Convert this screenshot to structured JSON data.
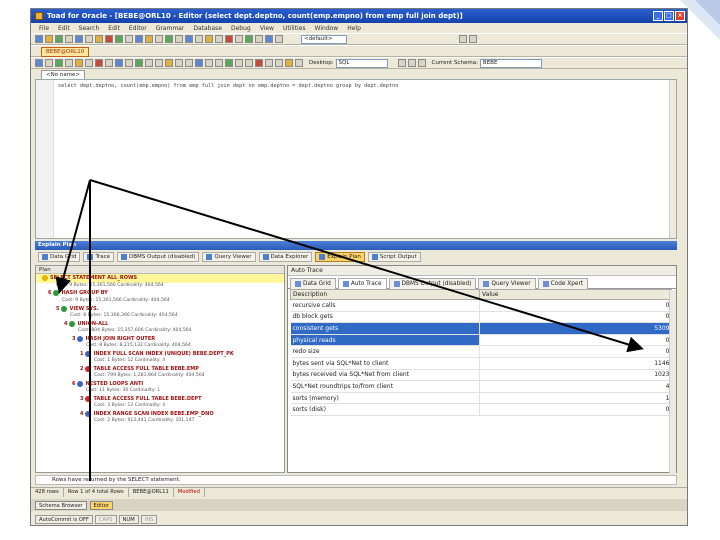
{
  "window": {
    "title": "Toad for Oracle - [BEBE@ORL10 - Editor (select dept.deptno, count(emp.empno) from emp full join dept)]"
  },
  "menu": [
    "File",
    "Edit",
    "Search",
    "Edit",
    "Editor",
    "Grammar",
    "Database",
    "Debug",
    "View",
    "Utilities",
    "Window",
    "Help"
  ],
  "toolbar": {
    "default_combo": "<default>",
    "desktop_label": "Desktop:",
    "desktop_value": "SQL",
    "schema_label": "Current Schema:",
    "schema_value": "BEBE"
  },
  "connection_tab": "BEBE@ORL10",
  "editor": {
    "tab_label": "<No name>",
    "sql": "select dept.deptno, count(emp.empno) from emp full join dept on emp.deptno = dept.deptno group by dept.deptno"
  },
  "explain": {
    "title": "Explain Plan",
    "tabs": [
      "Data Grid",
      "Trace",
      "DBMS Output (disabled)",
      "Query Viewer",
      "Data Explorer",
      "Explain Plan",
      "Script Output"
    ],
    "plan_header": "Plan",
    "nodes": [
      {
        "label": "SELECT STATEMENT ALL_ROWS",
        "cost": "Cost: 9 Bytes: 15,361,566  Cardinality: 404,564"
      },
      {
        "num": "6",
        "label": "HASH GROUP BY",
        "cost": "Cost: 9 Bytes: 15,361,566  Cardinality: 404,564"
      },
      {
        "num": "5",
        "label": "VIEW SYS.",
        "cost": "Cost: 8 Bytes: 15,366,366  Cardinality: 404,564"
      },
      {
        "num": "4",
        "label": "UNION-ALL",
        "cost": "Cost: 804 Bytes: 15,357,606  Cardinality: 404,564"
      },
      {
        "num": "3",
        "label": "HASH JOIN RIGHT OUTER",
        "cost": "Cost: 8 Bytes: 8,215,132  Cardinality: 404,564"
      },
      {
        "num": "1",
        "label": "INDEX FULL SCAN INDEX (UNIQUE) BEBE.DEPT_PK",
        "cost": "Cost: 1 Bytes: 12  Cardinality: 4"
      },
      {
        "num": "2",
        "label": "TABLE ACCESS FULL TABLE BEBE.EMP",
        "cost": "Cost: 799 Bytes: 1,281,864  Cardinality: 404,564"
      },
      {
        "num": "6",
        "label": "NESTED LOOPS ANTI",
        "cost": "Cost: 11 Bytes: 30  Cardinality: 1"
      },
      {
        "num": "3",
        "label": "TABLE ACCESS FULL TABLE BEBE.DEPT",
        "cost": "Cost: 3 Bytes: 12  Cardinality: 4"
      },
      {
        "num": "4",
        "label": "INDEX RANGE SCAN INDEX BEBE.EMP_DNO",
        "cost": "Cost: 2 Bytes: 912,441  Cardinality: 101,147"
      }
    ],
    "message": "Rows have returned by the SELECT statement."
  },
  "autotrace": {
    "title": "Auto Trace",
    "tabs": [
      "Data Grid",
      "Auto Trace",
      "DBMS Output (disabled)",
      "Query Viewer",
      "Code Xpert"
    ],
    "columns": [
      "Description",
      "Value"
    ],
    "rows": [
      {
        "desc": "recursive calls",
        "value": "0"
      },
      {
        "desc": "db block gets",
        "value": "0"
      },
      {
        "desc": "consistent gets",
        "value": "5309"
      },
      {
        "desc": "physical reads",
        "value": "0"
      },
      {
        "desc": "redo size",
        "value": "0"
      },
      {
        "desc": "bytes sent via SQL*Net to client",
        "value": "1146"
      },
      {
        "desc": "bytes received via SQL*Net from client",
        "value": "1023"
      },
      {
        "desc": "SQL*Net roundtrips to/from client",
        "value": "4"
      },
      {
        "desc": "sorts (memory)",
        "value": "1"
      },
      {
        "desc": "sorts (disk)",
        "value": "0"
      }
    ],
    "selected_row": 2
  },
  "status": {
    "rows": "428 rows",
    "position": "Row 1 of 4 total Rows",
    "conn": "BEBE@ORL11",
    "modified": "Modified"
  },
  "taskbar": [
    "Schema Browser",
    "Editor"
  ],
  "footer": [
    "AutoCommit is OFF",
    "CAPS",
    "NUM",
    "INS"
  ],
  "colors": {
    "selected_row": "#316ac5",
    "arrow": "#000000",
    "title_bar": "#1542a8"
  }
}
